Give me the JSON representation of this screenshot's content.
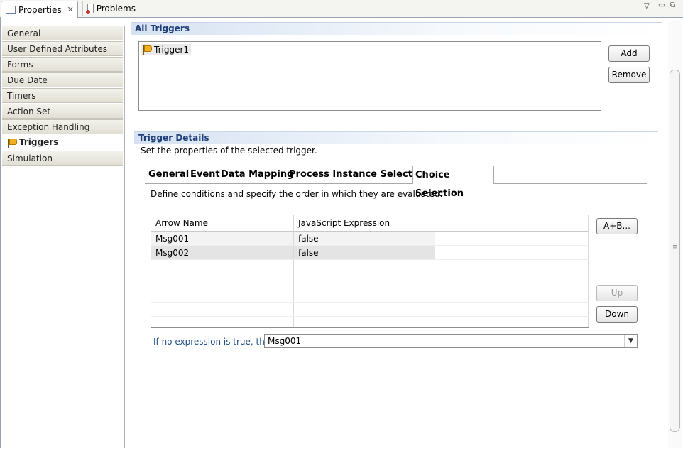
{
  "tabs": [
    {
      "label": "Properties",
      "icon": "properties-icon",
      "active": true
    },
    {
      "label": "Problems",
      "icon": "problems-icon",
      "active": false
    }
  ],
  "window_controls": [
    "view-menu-icon",
    "minimize-icon",
    "maximize-icon"
  ],
  "sidebar": {
    "items": [
      {
        "label": "General"
      },
      {
        "label": "User Defined Attributes"
      },
      {
        "label": "Forms"
      },
      {
        "label": "Due Date"
      },
      {
        "label": "Timers"
      },
      {
        "label": "Action Set"
      },
      {
        "label": "Exception Handling"
      },
      {
        "label": "Triggers",
        "selected": true
      },
      {
        "label": "Simulation"
      }
    ]
  },
  "all_triggers": {
    "header": "All Triggers",
    "items": [
      "Trigger1"
    ],
    "add_label": "Add",
    "remove_label": "Remove"
  },
  "trigger_details": {
    "header": "Trigger Details",
    "description": "Set the properties of the selected trigger.",
    "tabs": [
      "General",
      "Event",
      "Data Mapping",
      "Process Instance Selection",
      "Choice Selection"
    ],
    "selected_tab": "Choice Selection",
    "instructions": "Define conditions and specify the order in which they are evaluated:",
    "table": {
      "columns": [
        "Arrow Name",
        "JavaScript Expression"
      ],
      "rows": [
        [
          "Msg001",
          "false"
        ],
        [
          "Msg002",
          "false"
        ]
      ]
    },
    "expr_button_label": "A+B...",
    "up_label": "Up",
    "down_label": "Down",
    "fallback_label": "If no expression is true, then:",
    "fallback_value": "Msg001"
  },
  "colors": {
    "section_header_text": "#1f3f78",
    "link_label": "#1f4f8a"
  }
}
